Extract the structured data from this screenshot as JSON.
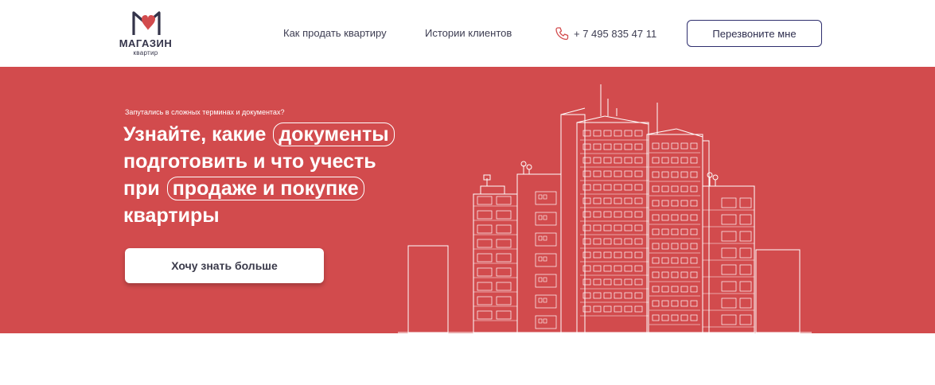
{
  "header": {
    "logo": {
      "name": "МАГАЗИН",
      "subtitle": "квартир"
    },
    "nav": [
      {
        "label": "Как продать квартиру"
      },
      {
        "label": "Истории клиентов"
      }
    ],
    "phone": {
      "icon": "phone-icon",
      "number": "+ 7 495 835 47 11"
    },
    "callback_button": "Перезвоните мне"
  },
  "hero": {
    "eyebrow": "Запутались в сложных терминах и документах?",
    "headline": {
      "line1_plain": "Узнайте, какие",
      "line1_pill": "документы",
      "line2": "подготовить и что учесть",
      "line3_plain": "при",
      "line3_pill": "продаже и покупке",
      "line4": "квартиры"
    },
    "cta_button": "Хочу знать больше",
    "illustration": "building-illustration"
  },
  "colors": {
    "brand_red": "#d24b4d",
    "navy": "#2e2e6e",
    "text": "#3d3d52"
  }
}
